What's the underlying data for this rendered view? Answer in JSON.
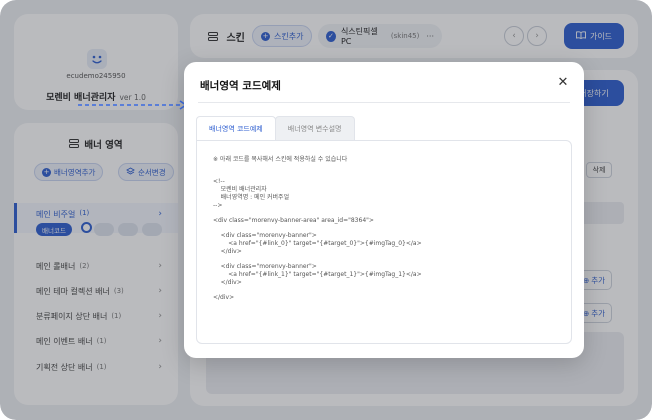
{
  "profile": {
    "username": "ecudemo245950",
    "app_name": "모렌비 배너관리자",
    "version": "ver 1.0"
  },
  "banner_area": {
    "title": "배너 영역",
    "add_button": "배너영역추가",
    "order_button": "순서변경",
    "items": [
      {
        "label": "메인 비주얼",
        "count": "(1)"
      },
      {
        "label": "메인 롤배너",
        "count": "(2)"
      },
      {
        "label": "메인 테마 컬렉션 배너",
        "count": "(3)"
      },
      {
        "label": "분류페이지 상단 배너",
        "count": "(1)"
      },
      {
        "label": "메인 이벤트 배너",
        "count": "(1)"
      },
      {
        "label": "기획전 상단 배너",
        "count": "(1)"
      }
    ],
    "code_tag": "배너코드"
  },
  "topbar": {
    "skin_label": "스킨",
    "skin_add": "스킨추가",
    "skin_name": "식스틴픽셀 PC",
    "skin_id": "(skin45)",
    "more": "···",
    "prev": "‹",
    "next": "›",
    "guide": "가이드"
  },
  "main": {
    "save": "저장하기",
    "delete": "삭제",
    "add": "추가"
  },
  "modal": {
    "title": "배너영역 코드예제",
    "close": "✕",
    "tabs": [
      "배너영역 코드예제",
      "배너영역 변수설명"
    ],
    "code": {
      "notice": "※ 아래 코드를 복사해서 스킨에 적용하실 수 있습니다",
      "c1": "<!--",
      "c2": "    모렌비 배너관리자",
      "c3": "    배너영역명 : 메인 커버주얼",
      "c4": "-->",
      "d1": "<div class=\"morenvy-banner-area\" area_id=\"8364\">",
      "b1": "    <div class=\"morenvy-banner\">",
      "b1a": "        <a href=\"{#link_0}\" target=\"{#target_0}\">{#imgTag_0}</a>",
      "b1c": "    </div>",
      "b2": "    <div class=\"morenvy-banner\">",
      "b2a": "        <a href=\"{#link_1}\" target=\"{#target_1}\">{#imgTag_1}</a>",
      "b2c": "    </div>",
      "d2": "</div>"
    }
  },
  "colors": {
    "accent": "#2f5fd0",
    "background": "#eef0f4"
  }
}
